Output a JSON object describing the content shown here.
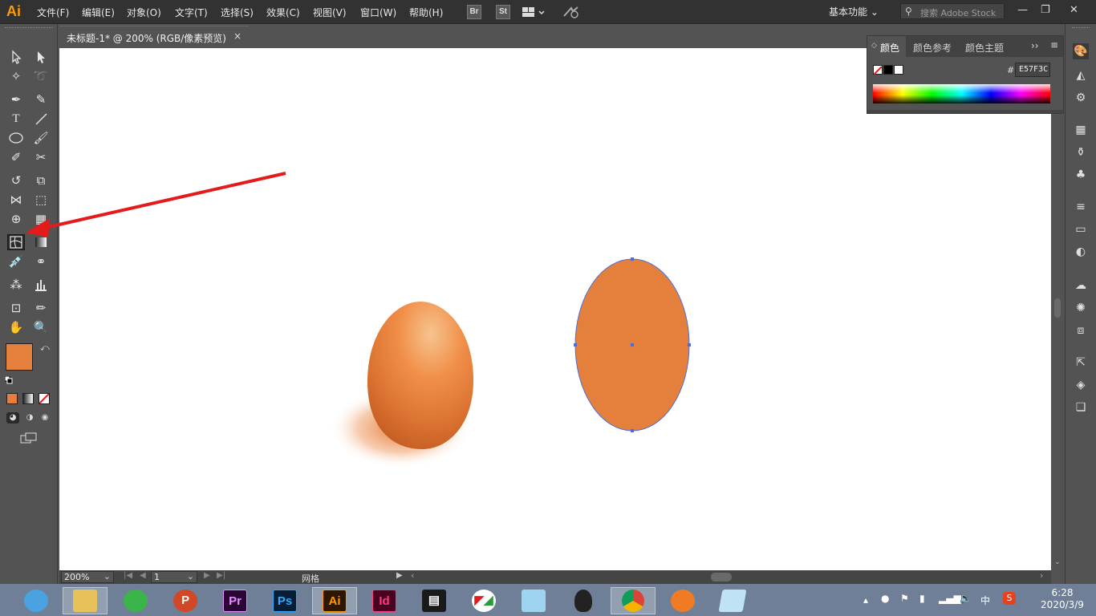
{
  "app": {
    "logo": "Ai"
  },
  "menu": [
    "文件(F)",
    "编辑(E)",
    "对象(O)",
    "文字(T)",
    "选择(S)",
    "效果(C)",
    "视图(V)",
    "窗口(W)",
    "帮助(H)"
  ],
  "toolbar_icons": {
    "bridge": "Br",
    "stock": "St"
  },
  "workspace": {
    "label": "基本功能"
  },
  "search": {
    "placeholder": "搜索 Adobe Stock"
  },
  "document": {
    "tab_title": "未标题-1* @ 200% (RGB/像素预览)",
    "close": "×"
  },
  "status": {
    "zoom": "200%",
    "artboard": "1",
    "tool_name": "网格"
  },
  "color_panel": {
    "tabs": [
      "颜色",
      "颜色参考",
      "颜色主题"
    ],
    "hex_label": "#",
    "hex_value": "E57F3C"
  },
  "colors": {
    "fill": "#e57f3c",
    "accent": "#ff9a00",
    "arrow": "#e31b1b",
    "selection": "#4a6ee0"
  },
  "taskbar": {
    "apps": [
      "browser-icon",
      "file-explorer-icon",
      "wechat-icon",
      "powerpoint-icon",
      "premiere-icon",
      "photoshop-icon",
      "illustrator-icon",
      "indesign-icon",
      "video-icon",
      "app-icon",
      "app2-icon",
      "qq-icon",
      "chrome-icon",
      "app3-icon",
      "app4-icon"
    ],
    "labels": {
      "powerpoint": "P",
      "premiere": "Pr",
      "photoshop": "Ps",
      "illustrator": "Ai",
      "indesign": "Id"
    },
    "ime": "中",
    "time": "6:28",
    "date": "2020/3/9"
  }
}
